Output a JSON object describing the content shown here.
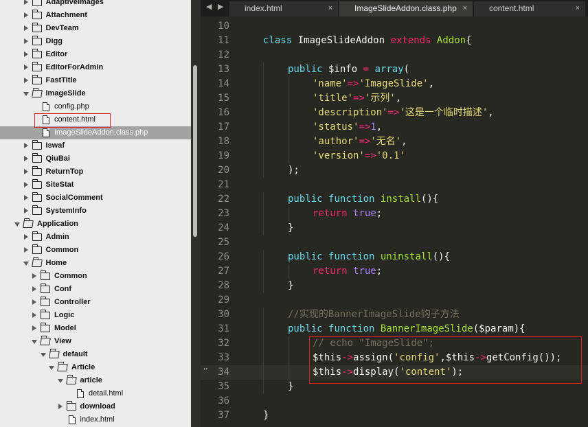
{
  "sidebar": {
    "items": [
      {
        "label": "AdaptiveImages",
        "type": "folder",
        "depth": 1,
        "expanded": false
      },
      {
        "label": "Attachment",
        "type": "folder",
        "depth": 1,
        "expanded": false
      },
      {
        "label": "DevTeam",
        "type": "folder",
        "depth": 1,
        "expanded": false
      },
      {
        "label": "Digg",
        "type": "folder",
        "depth": 1,
        "expanded": false
      },
      {
        "label": "Editor",
        "type": "folder",
        "depth": 1,
        "expanded": false
      },
      {
        "label": "EditorForAdmin",
        "type": "folder",
        "depth": 1,
        "expanded": false
      },
      {
        "label": "FastTitle",
        "type": "folder",
        "depth": 1,
        "expanded": false
      },
      {
        "label": "ImageSlide",
        "type": "folder",
        "depth": 1,
        "expanded": true
      },
      {
        "label": "config.php",
        "type": "file",
        "depth": 2
      },
      {
        "label": "content.html",
        "type": "file",
        "depth": 2
      },
      {
        "label": "ImageSlideAddon.class.php",
        "type": "file",
        "depth": 2,
        "selected": true
      },
      {
        "label": "Iswaf",
        "type": "folder",
        "depth": 1,
        "expanded": false
      },
      {
        "label": "QiuBai",
        "type": "folder",
        "depth": 1,
        "expanded": false
      },
      {
        "label": "ReturnTop",
        "type": "folder",
        "depth": 1,
        "expanded": false
      },
      {
        "label": "SiteStat",
        "type": "folder",
        "depth": 1,
        "expanded": false
      },
      {
        "label": "SocialComment",
        "type": "folder",
        "depth": 1,
        "expanded": false
      },
      {
        "label": "SystemInfo",
        "type": "folder",
        "depth": 1,
        "expanded": false
      },
      {
        "label": "Application",
        "type": "folder",
        "depth": 0,
        "expanded": true
      },
      {
        "label": "Admin",
        "type": "folder",
        "depth": 1,
        "expanded": false
      },
      {
        "label": "Common",
        "type": "folder",
        "depth": 1,
        "expanded": false
      },
      {
        "label": "Home",
        "type": "folder",
        "depth": 1,
        "expanded": true
      },
      {
        "label": "Common",
        "type": "folder",
        "depth": 2,
        "expanded": false
      },
      {
        "label": "Conf",
        "type": "folder",
        "depth": 2,
        "expanded": false
      },
      {
        "label": "Controller",
        "type": "folder",
        "depth": 2,
        "expanded": false
      },
      {
        "label": "Logic",
        "type": "folder",
        "depth": 2,
        "expanded": false
      },
      {
        "label": "Model",
        "type": "folder",
        "depth": 2,
        "expanded": false
      },
      {
        "label": "View",
        "type": "folder",
        "depth": 2,
        "expanded": true
      },
      {
        "label": "default",
        "type": "folder",
        "depth": 3,
        "expanded": true
      },
      {
        "label": "Article",
        "type": "folder",
        "depth": 4,
        "expanded": true
      },
      {
        "label": "article",
        "type": "folder",
        "depth": 5,
        "expanded": true
      },
      {
        "label": "detail.html",
        "type": "file",
        "depth": 6
      },
      {
        "label": "download",
        "type": "folder",
        "depth": 5,
        "expanded": false
      },
      {
        "label": "index.html",
        "type": "file",
        "depth": 5
      }
    ]
  },
  "tabs": [
    {
      "label": "index.html",
      "close": "×",
      "active": false
    },
    {
      "label": "ImageSlideAddon.class.php",
      "close": "×",
      "active": true
    },
    {
      "label": "content.html",
      "close": "×",
      "active": false
    }
  ],
  "nav": {
    "back": "◀",
    "forward": "▶"
  },
  "gutter_marker": "‘’",
  "code": {
    "lines": [
      {
        "n": "10",
        "indent": 0,
        "tokens": []
      },
      {
        "n": "11",
        "indent": 1,
        "tokens": [
          [
            "kw",
            "class"
          ],
          [
            "def",
            " ImageSlideAddon "
          ],
          [
            "mag",
            "extends"
          ],
          [
            "def",
            " "
          ],
          [
            "grn",
            "Addon"
          ],
          [
            "def",
            "{"
          ]
        ]
      },
      {
        "n": "12",
        "indent": 0,
        "tokens": []
      },
      {
        "n": "13",
        "indent": 2,
        "tokens": [
          [
            "kw",
            "public"
          ],
          [
            "def",
            " $info "
          ],
          [
            "mag",
            "="
          ],
          [
            "def",
            " "
          ],
          [
            "kw",
            "array"
          ],
          [
            "def",
            "("
          ]
        ]
      },
      {
        "n": "14",
        "indent": 3,
        "tokens": [
          [
            "str",
            "'name'"
          ],
          [
            "mag",
            "=>"
          ],
          [
            "str",
            "'ImageSlide'"
          ],
          [
            "def",
            ","
          ]
        ]
      },
      {
        "n": "15",
        "indent": 3,
        "tokens": [
          [
            "str",
            "'title'"
          ],
          [
            "mag",
            "=>"
          ],
          [
            "str",
            "'示列'"
          ],
          [
            "def",
            ","
          ]
        ]
      },
      {
        "n": "16",
        "indent": 3,
        "tokens": [
          [
            "str",
            "'description'"
          ],
          [
            "mag",
            "=>"
          ],
          [
            "str",
            "'这是一个临时描述'"
          ],
          [
            "def",
            ","
          ]
        ]
      },
      {
        "n": "17",
        "indent": 3,
        "tokens": [
          [
            "str",
            "'status'"
          ],
          [
            "mag",
            "=>"
          ],
          [
            "num",
            "1"
          ],
          [
            "def",
            ","
          ]
        ]
      },
      {
        "n": "18",
        "indent": 3,
        "tokens": [
          [
            "str",
            "'author'"
          ],
          [
            "mag",
            "=>"
          ],
          [
            "str",
            "'无名'"
          ],
          [
            "def",
            ","
          ]
        ]
      },
      {
        "n": "19",
        "indent": 3,
        "tokens": [
          [
            "str",
            "'version'"
          ],
          [
            "mag",
            "=>"
          ],
          [
            "str",
            "'0.1'"
          ]
        ]
      },
      {
        "n": "20",
        "indent": 2,
        "tokens": [
          [
            "def",
            ");"
          ]
        ]
      },
      {
        "n": "21",
        "indent": 0,
        "tokens": []
      },
      {
        "n": "22",
        "indent": 2,
        "tokens": [
          [
            "kw",
            "public"
          ],
          [
            "def",
            " "
          ],
          [
            "kw",
            "function"
          ],
          [
            "def",
            " "
          ],
          [
            "grn",
            "install"
          ],
          [
            "def",
            "(){"
          ]
        ]
      },
      {
        "n": "23",
        "indent": 3,
        "tokens": [
          [
            "mag",
            "return"
          ],
          [
            "def",
            " "
          ],
          [
            "num",
            "true"
          ],
          [
            "def",
            ";"
          ]
        ]
      },
      {
        "n": "24",
        "indent": 2,
        "tokens": [
          [
            "def",
            "}"
          ]
        ]
      },
      {
        "n": "25",
        "indent": 0,
        "tokens": []
      },
      {
        "n": "26",
        "indent": 2,
        "tokens": [
          [
            "kw",
            "public"
          ],
          [
            "def",
            " "
          ],
          [
            "kw",
            "function"
          ],
          [
            "def",
            " "
          ],
          [
            "grn",
            "uninstall"
          ],
          [
            "def",
            "(){"
          ]
        ]
      },
      {
        "n": "27",
        "indent": 3,
        "tokens": [
          [
            "mag",
            "return"
          ],
          [
            "def",
            " "
          ],
          [
            "num",
            "true"
          ],
          [
            "def",
            ";"
          ]
        ]
      },
      {
        "n": "28",
        "indent": 2,
        "tokens": [
          [
            "def",
            "}"
          ]
        ]
      },
      {
        "n": "29",
        "indent": 0,
        "tokens": []
      },
      {
        "n": "30",
        "indent": 2,
        "tokens": [
          [
            "cmt",
            "//实现的BannerImageSlide钩子方法"
          ]
        ]
      },
      {
        "n": "31",
        "indent": 2,
        "tokens": [
          [
            "kw",
            "public"
          ],
          [
            "def",
            " "
          ],
          [
            "kw",
            "function"
          ],
          [
            "def",
            " "
          ],
          [
            "grn",
            "BannerImageSlide"
          ],
          [
            "def",
            "($param){"
          ]
        ]
      },
      {
        "n": "32",
        "indent": 3,
        "tokens": [
          [
            "cmt",
            "// echo \"ImageSlide\";"
          ]
        ]
      },
      {
        "n": "33",
        "indent": 3,
        "tokens": [
          [
            "def",
            "$this"
          ],
          [
            "mag",
            "->"
          ],
          [
            "def",
            "assign("
          ],
          [
            "str",
            "'config'"
          ],
          [
            "def",
            ",$this"
          ],
          [
            "mag",
            "->"
          ],
          [
            "def",
            "getConfig());"
          ]
        ]
      },
      {
        "n": "34",
        "indent": 3,
        "current": true,
        "tokens": [
          [
            "def",
            "$this"
          ],
          [
            "mag",
            "->"
          ],
          [
            "def",
            "display("
          ],
          [
            "str",
            "'content'"
          ],
          [
            "def",
            ");"
          ]
        ]
      },
      {
        "n": "35",
        "indent": 2,
        "tokens": [
          [
            "def",
            "}"
          ]
        ]
      },
      {
        "n": "36",
        "indent": 0,
        "tokens": []
      },
      {
        "n": "37",
        "indent": 1,
        "tokens": [
          [
            "def",
            "}"
          ]
        ]
      }
    ]
  },
  "colors": {
    "editor_bg": "#272822",
    "sidebar_bg": "#ececec",
    "selection": "#a3a3a3",
    "highlight_box": "#e01c1c",
    "keyword": "#66d9ef",
    "operator": "#f92672",
    "string": "#e6db74",
    "name": "#a6e22e",
    "number": "#ae81ff",
    "comment": "#75715e"
  }
}
